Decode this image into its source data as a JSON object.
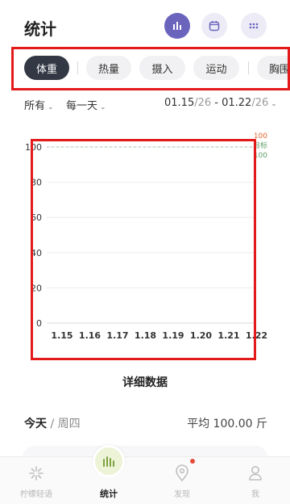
{
  "header": {
    "title": "统计",
    "buttons": [
      {
        "name": "stats-icon",
        "active": true
      },
      {
        "name": "calendar-icon",
        "active": false
      },
      {
        "name": "grid-icon",
        "active": false
      }
    ]
  },
  "tabs": [
    {
      "label": "体重",
      "active": true
    },
    {
      "label": "热量",
      "active": false
    },
    {
      "label": "摄入",
      "active": false
    },
    {
      "label": "运动",
      "active": false
    },
    {
      "label": "胸围",
      "active": false
    }
  ],
  "filters": {
    "scope": "所有",
    "period": "每一天",
    "date_start": "01.15",
    "date_start_year": "/26",
    "date_sep": " - ",
    "date_end": "01.22",
    "date_end_year": "/26"
  },
  "chart_data": {
    "type": "line",
    "categories": [
      "1.15",
      "1.16",
      "1.17",
      "1.18",
      "1.19",
      "1.20",
      "1.21",
      "1.22"
    ],
    "series": [],
    "ylim": [
      0,
      100
    ],
    "yticks": [
      0,
      20,
      40,
      60,
      80,
      100
    ],
    "goal": {
      "value": 100,
      "label_top": "100",
      "label_mid": "目标",
      "label_bottom": "100"
    },
    "grid": true
  },
  "detail": {
    "title": "详细数据"
  },
  "summary": {
    "day": "今天",
    "sep": " / ",
    "weekday": "周四",
    "average": "平均 100.00 斤"
  },
  "nav": [
    {
      "label": "柠檬轻语",
      "icon": "lemon-icon",
      "active": false
    },
    {
      "label": "统计",
      "icon": "bar-chart-icon",
      "active": true
    },
    {
      "label": "发现",
      "icon": "location-pin-icon",
      "active": false
    },
    {
      "label": "我",
      "icon": "person-icon",
      "active": false
    }
  ],
  "colors": {
    "accent": "#6a64bd",
    "tab_active": "#323844",
    "highlight": "#e21a1a",
    "goal_green": "#63a06b",
    "goal_orange": "#e0652b",
    "nav_active_bg": "#edf3d6"
  }
}
